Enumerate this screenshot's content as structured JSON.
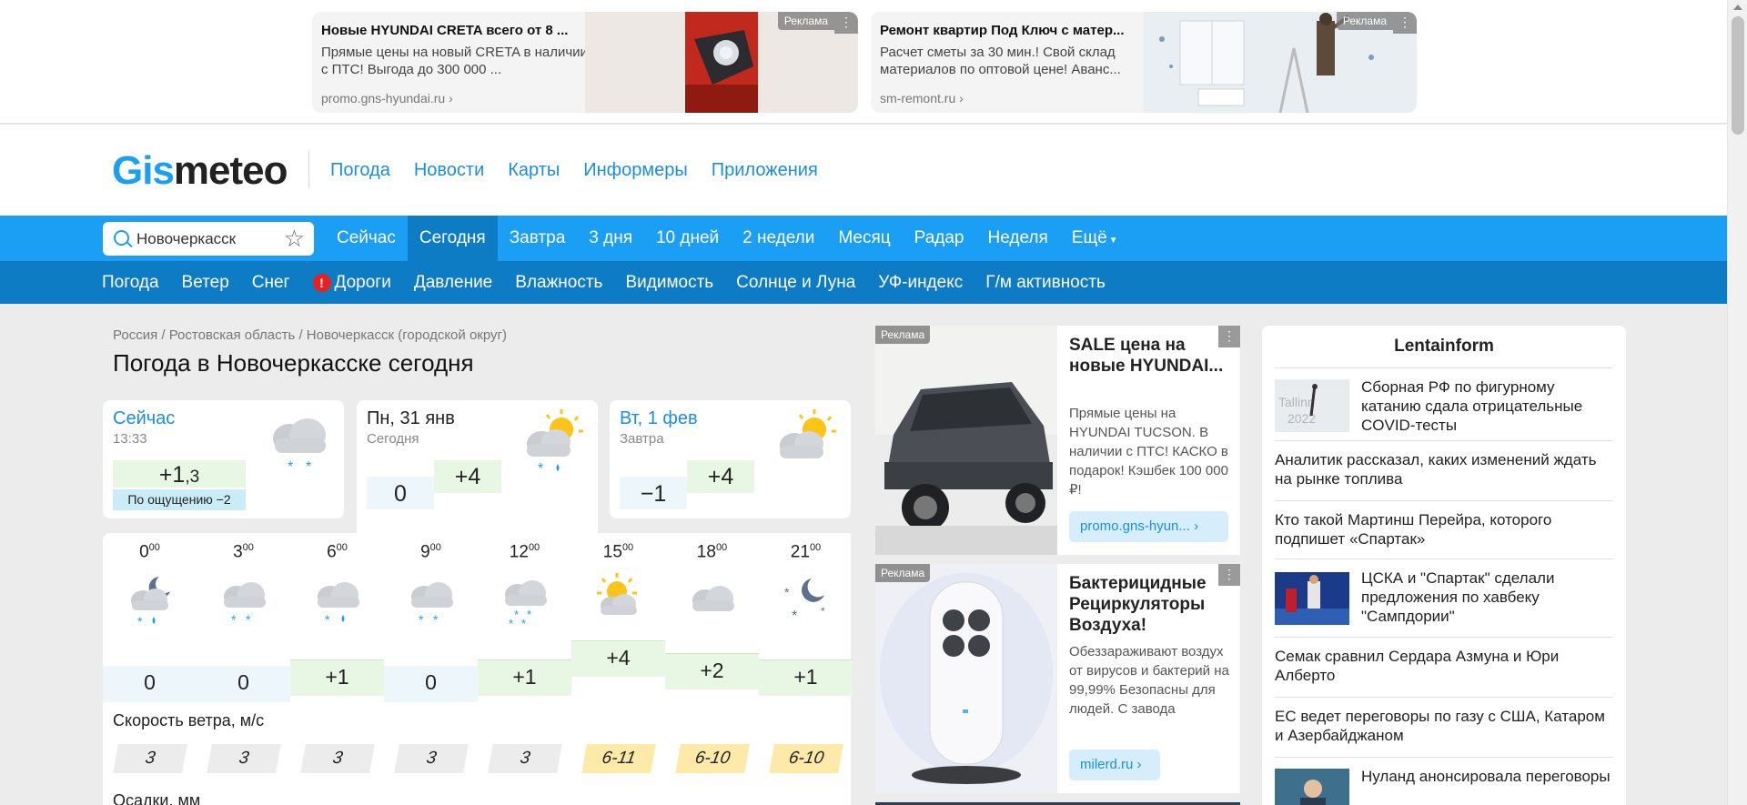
{
  "top_ads": [
    {
      "title": "Новые HYUNDAI CRETA всего от 8 ...",
      "text": "Прямые цены на новый CRETA в наличии с ПТС! Выгода до 300 000 ...",
      "source": "promo.gns-hyundai.ru",
      "badge": "Реклама"
    },
    {
      "title": "Ремонт квартир Под Ключ с матер...",
      "text": "Расчет сметы за 30 мин.! Свой склад материалов по оптовой цене! Аванс...",
      "source": "sm-remont.ru",
      "badge": "Реклама"
    }
  ],
  "header": {
    "logo_prefix": "Gis",
    "logo_suffix": "meteo",
    "nav": [
      "Погода",
      "Новости",
      "Карты",
      "Информеры",
      "Приложения"
    ]
  },
  "search": {
    "value": "Новочеркасск"
  },
  "nav_primary": [
    "Сейчас",
    "Сегодня",
    "Завтра",
    "3 дня",
    "10 дней",
    "2 недели",
    "Месяц",
    "Радар",
    "Неделя",
    "Ещё"
  ],
  "nav_secondary": [
    "Погода",
    "Ветер",
    "Снег",
    "Дороги",
    "Давление",
    "Влажность",
    "Видимость",
    "Солнце и Луна",
    "УФ-индекс",
    "Г/м активность"
  ],
  "breadcrumb": "Россия / Ростовская область / Новочеркасск (городской округ)",
  "page_title": "Погода в Новочеркасске сегодня",
  "now_card": {
    "title": "Сейчас",
    "time": "13:33",
    "temp_main": "+1",
    "temp_frac": ",3",
    "feels": "По ощущению −2"
  },
  "today_card": {
    "title": "Пн, 31 янв",
    "sub": "Сегодня",
    "tmin": "0",
    "tmax": "+4"
  },
  "tomorrow_card": {
    "title": "Вт, 1 фев",
    "sub": "Завтра",
    "tmin": "−1",
    "tmax": "+4"
  },
  "hourly": {
    "hours": [
      "0",
      "3",
      "6",
      "9",
      "12",
      "15",
      "18",
      "21"
    ],
    "minutes": "00",
    "icons": [
      "night-cloud-snow-rain-icon",
      "cloud-snow-icon",
      "cloud-snow-rain-icon",
      "cloud-snow-icon",
      "cloud-heavy-snow-icon",
      "sun-cloud-icon",
      "cloud-icon",
      "night-snow-icon"
    ],
    "temps": [
      "0",
      "0",
      "+1",
      "0",
      "+1",
      "+4",
      "+2",
      "+1"
    ],
    "temp_values": [
      0,
      0,
      1,
      0,
      1,
      4,
      2,
      1
    ],
    "wind_title": "Скорость ветра, м/с",
    "wind": [
      "3",
      "3",
      "3",
      "3",
      "3",
      "6-11",
      "6-10",
      "6-10"
    ],
    "precip_title": "Осадки, мм"
  },
  "side_ads": [
    {
      "badge": "Реклама",
      "title": "SALE цена на новые HYUNDAI...",
      "text": "Прямые цены на HYUNDAI TUCSON. В наличии с ПТС! КАСКО в подарок! Кэшбек 100 000 ₽!",
      "link": "promo.gns-hyun..."
    },
    {
      "badge": "Реклама",
      "title": "Бактерицидные Рециркуляторы Воздуха!",
      "text": "Обеззараживают воздух от вирусов и бактерий на 99,99% Безопасны для людей. С завода",
      "link": "milerd.ru"
    }
  ],
  "news": {
    "heading": "Lentainform",
    "items": [
      "Сборная РФ по фигурному катанию сдала отрицательные COVID-тесты",
      "Аналитик рассказал, каких изменений ждать на рынке топлива",
      "Кто такой Мартинш Перейра, которого подпишет «Спартак»",
      "ЦСКА и \"Спартак\" сделали предложения по хавбеку \"Сампдории\"",
      "Семак сравнил Сердара Азмуна и Юри Алберто",
      "ЕС ведет переговоры по газу с США, Катаром и Азербайджаном",
      "Нуланд анонсировала переговоры Лаврова и Блинкена"
    ]
  },
  "colors": {
    "brand": "#1a9ff5",
    "nav_dark": "#0d7cc4",
    "warm": "#e8f7e3",
    "cold": "#edf6fb",
    "wind_strong": "#fde9a8"
  }
}
